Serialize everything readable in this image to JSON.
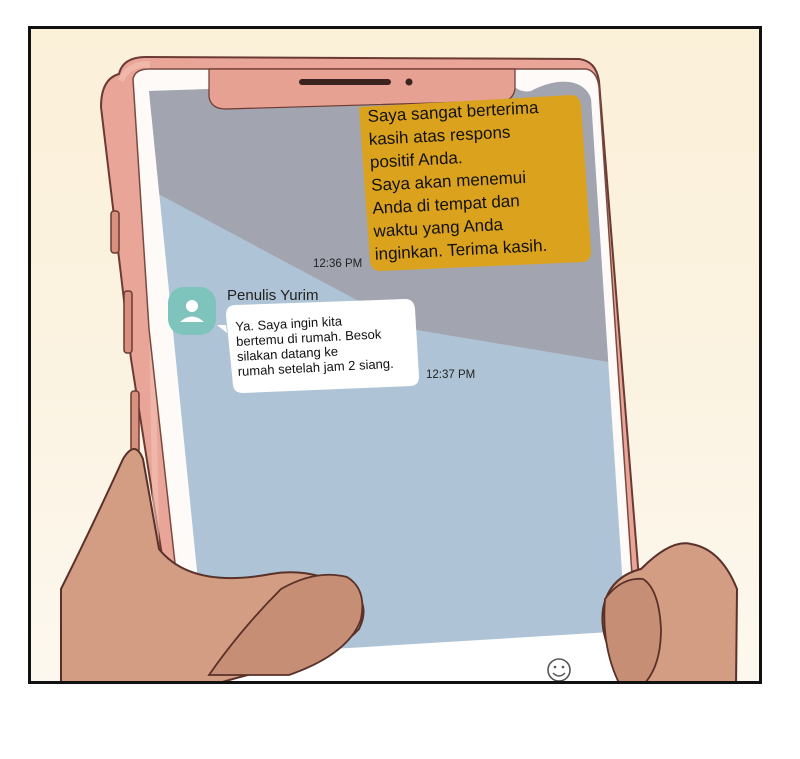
{
  "chat": {
    "outgoing_message": {
      "text": "Saya sangat berterima\nkasih atas respons\npositif Anda.\nSaya akan menemui\nAnda di tempat dan\nwaktu yang Anda\ninginkan. Terima kasih.",
      "timestamp": "12:36 PM"
    },
    "incoming_message": {
      "sender": "Penulis Yurim",
      "text": "Ya. Saya ingin kita\nbertemu di rumah. Besok\nsilakan datang ke\nrumah setelah jam 2 siang.",
      "timestamp": "12:37 PM"
    },
    "emoji_icon": "smiley-face-icon"
  },
  "colors": {
    "outgoing_bubble": "#dba21d",
    "chat_background": "#aec4d6",
    "avatar": "#7ec3bc",
    "phone_body": "#e9a597"
  }
}
